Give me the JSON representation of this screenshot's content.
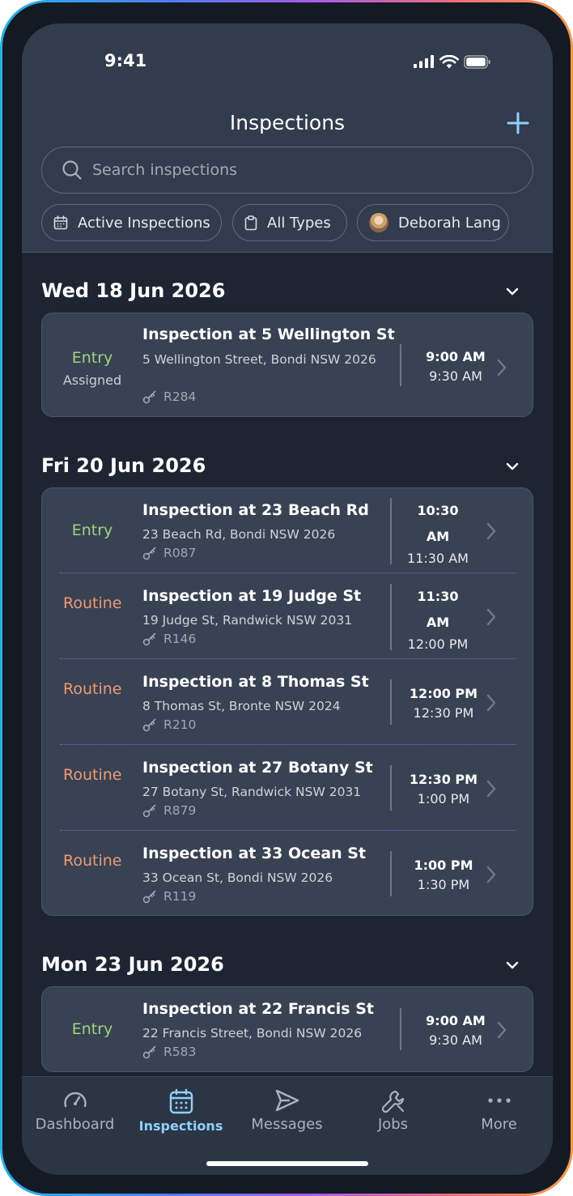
{
  "status_bar": {
    "time": "9:41"
  },
  "header": {
    "title": "Inspections",
    "search_placeholder": "Search inspections",
    "filters": [
      {
        "label": "Active Inspections",
        "icon": "calendar-icon"
      },
      {
        "label": "All Types",
        "icon": "clipboard-icon"
      },
      {
        "label": "Deborah Lang",
        "icon": "avatar"
      }
    ]
  },
  "groups": [
    {
      "date": "Wed 18 Jun 2026",
      "items": [
        {
          "type": "Entry",
          "type_class": "entry",
          "status": "Assigned",
          "title": "Inspection at 5 Wellington St",
          "address": "5 Wellington Street, Bondi NSW 2026",
          "ref": "R284",
          "start": "9:00 AM",
          "end": "9:30 AM"
        }
      ]
    },
    {
      "date": "Fri 20 Jun 2026",
      "items": [
        {
          "type": "Entry",
          "type_class": "entry",
          "title": "Inspection at 23 Beach Rd",
          "address": "23 Beach Rd, Bondi NSW 2026",
          "ref": "R087",
          "start": "10:30 AM",
          "end": "11:30 AM"
        },
        {
          "type": "Routine",
          "type_class": "routine",
          "title": "Inspection at 19 Judge St",
          "address": "19 Judge St, Randwick NSW 2031",
          "ref": "R146",
          "start": "11:30 AM",
          "end": "12:00 PM"
        },
        {
          "type": "Routine",
          "type_class": "routine",
          "title": "Inspection at 8 Thomas St",
          "address": "8 Thomas St, Bronte NSW 2024",
          "ref": "R210",
          "start": "12:00 PM",
          "end": "12:30 PM"
        },
        {
          "type": "Routine",
          "type_class": "routine",
          "title": "Inspection at 27 Botany St",
          "address": "27 Botany St, Randwick NSW 2031",
          "ref": "R879",
          "start": "12:30 PM",
          "end": "1:00 PM"
        },
        {
          "type": "Routine",
          "type_class": "routine",
          "title": "Inspection at 33 Ocean St",
          "address": "33 Ocean St, Bondi NSW 2026",
          "ref": "R119",
          "start": "1:00 PM",
          "end": "1:30 PM"
        }
      ]
    },
    {
      "date": "Mon 23 Jun 2026",
      "items": [
        {
          "type": "Entry",
          "type_class": "entry",
          "title": "Inspection at 22 Francis St",
          "address": "22 Francis Street, Bondi NSW 2026",
          "ref": "R583",
          "start": "9:00 AM",
          "end": "9:30 AM"
        }
      ]
    }
  ],
  "tabbar": {
    "tabs": [
      {
        "label": "Dashboard",
        "icon": "gauge-icon"
      },
      {
        "label": "Inspections",
        "icon": "calendar-icon",
        "active": true
      },
      {
        "label": "Messages",
        "icon": "send-icon"
      },
      {
        "label": "Jobs",
        "icon": "wrench-icon"
      },
      {
        "label": "More",
        "icon": "more-dots-icon"
      }
    ]
  },
  "colors": {
    "entry": "#a3d37e",
    "routine": "#ee9a74",
    "active_tab": "#8fd0ff",
    "background": "#1d2532",
    "card": "#384253"
  }
}
